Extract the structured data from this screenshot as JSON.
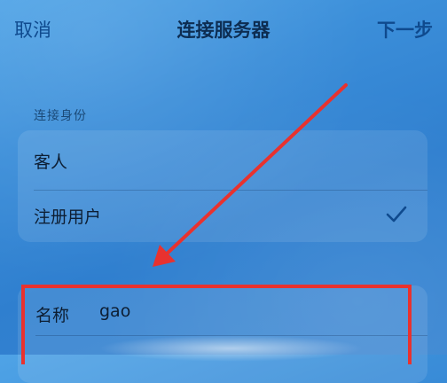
{
  "nav": {
    "cancel_label": "取消",
    "title": "连接服务器",
    "next_label": "下一步"
  },
  "connection_identity": {
    "header": "连接身份",
    "options": [
      {
        "label": "客人",
        "selected": false
      },
      {
        "label": "注册用户",
        "selected": true
      }
    ],
    "check_icon": "checkmark-icon"
  },
  "credentials": {
    "name_label": "名称",
    "name_value": "gao"
  },
  "annotation": {
    "color": "#e8322f"
  }
}
